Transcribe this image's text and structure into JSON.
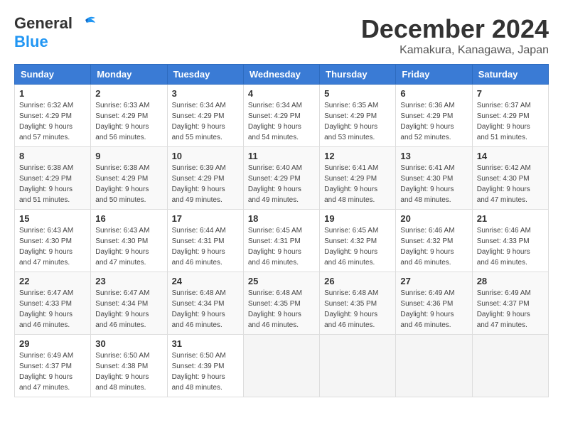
{
  "logo": {
    "general": "General",
    "blue": "Blue"
  },
  "header": {
    "month": "December 2024",
    "location": "Kamakura, Kanagawa, Japan"
  },
  "weekdays": [
    "Sunday",
    "Monday",
    "Tuesday",
    "Wednesday",
    "Thursday",
    "Friday",
    "Saturday"
  ],
  "weeks": [
    [
      {
        "day": "1",
        "sunrise": "6:32 AM",
        "sunset": "4:29 PM",
        "daylight": "9 hours and 57 minutes."
      },
      {
        "day": "2",
        "sunrise": "6:33 AM",
        "sunset": "4:29 PM",
        "daylight": "9 hours and 56 minutes."
      },
      {
        "day": "3",
        "sunrise": "6:34 AM",
        "sunset": "4:29 PM",
        "daylight": "9 hours and 55 minutes."
      },
      {
        "day": "4",
        "sunrise": "6:34 AM",
        "sunset": "4:29 PM",
        "daylight": "9 hours and 54 minutes."
      },
      {
        "day": "5",
        "sunrise": "6:35 AM",
        "sunset": "4:29 PM",
        "daylight": "9 hours and 53 minutes."
      },
      {
        "day": "6",
        "sunrise": "6:36 AM",
        "sunset": "4:29 PM",
        "daylight": "9 hours and 52 minutes."
      },
      {
        "day": "7",
        "sunrise": "6:37 AM",
        "sunset": "4:29 PM",
        "daylight": "9 hours and 51 minutes."
      }
    ],
    [
      {
        "day": "8",
        "sunrise": "6:38 AM",
        "sunset": "4:29 PM",
        "daylight": "9 hours and 51 minutes."
      },
      {
        "day": "9",
        "sunrise": "6:38 AM",
        "sunset": "4:29 PM",
        "daylight": "9 hours and 50 minutes."
      },
      {
        "day": "10",
        "sunrise": "6:39 AM",
        "sunset": "4:29 PM",
        "daylight": "9 hours and 49 minutes."
      },
      {
        "day": "11",
        "sunrise": "6:40 AM",
        "sunset": "4:29 PM",
        "daylight": "9 hours and 49 minutes."
      },
      {
        "day": "12",
        "sunrise": "6:41 AM",
        "sunset": "4:29 PM",
        "daylight": "9 hours and 48 minutes."
      },
      {
        "day": "13",
        "sunrise": "6:41 AM",
        "sunset": "4:30 PM",
        "daylight": "9 hours and 48 minutes."
      },
      {
        "day": "14",
        "sunrise": "6:42 AM",
        "sunset": "4:30 PM",
        "daylight": "9 hours and 47 minutes."
      }
    ],
    [
      {
        "day": "15",
        "sunrise": "6:43 AM",
        "sunset": "4:30 PM",
        "daylight": "9 hours and 47 minutes."
      },
      {
        "day": "16",
        "sunrise": "6:43 AM",
        "sunset": "4:30 PM",
        "daylight": "9 hours and 47 minutes."
      },
      {
        "day": "17",
        "sunrise": "6:44 AM",
        "sunset": "4:31 PM",
        "daylight": "9 hours and 46 minutes."
      },
      {
        "day": "18",
        "sunrise": "6:45 AM",
        "sunset": "4:31 PM",
        "daylight": "9 hours and 46 minutes."
      },
      {
        "day": "19",
        "sunrise": "6:45 AM",
        "sunset": "4:32 PM",
        "daylight": "9 hours and 46 minutes."
      },
      {
        "day": "20",
        "sunrise": "6:46 AM",
        "sunset": "4:32 PM",
        "daylight": "9 hours and 46 minutes."
      },
      {
        "day": "21",
        "sunrise": "6:46 AM",
        "sunset": "4:33 PM",
        "daylight": "9 hours and 46 minutes."
      }
    ],
    [
      {
        "day": "22",
        "sunrise": "6:47 AM",
        "sunset": "4:33 PM",
        "daylight": "9 hours and 46 minutes."
      },
      {
        "day": "23",
        "sunrise": "6:47 AM",
        "sunset": "4:34 PM",
        "daylight": "9 hours and 46 minutes."
      },
      {
        "day": "24",
        "sunrise": "6:48 AM",
        "sunset": "4:34 PM",
        "daylight": "9 hours and 46 minutes."
      },
      {
        "day": "25",
        "sunrise": "6:48 AM",
        "sunset": "4:35 PM",
        "daylight": "9 hours and 46 minutes."
      },
      {
        "day": "26",
        "sunrise": "6:48 AM",
        "sunset": "4:35 PM",
        "daylight": "9 hours and 46 minutes."
      },
      {
        "day": "27",
        "sunrise": "6:49 AM",
        "sunset": "4:36 PM",
        "daylight": "9 hours and 46 minutes."
      },
      {
        "day": "28",
        "sunrise": "6:49 AM",
        "sunset": "4:37 PM",
        "daylight": "9 hours and 47 minutes."
      }
    ],
    [
      {
        "day": "29",
        "sunrise": "6:49 AM",
        "sunset": "4:37 PM",
        "daylight": "9 hours and 47 minutes."
      },
      {
        "day": "30",
        "sunrise": "6:50 AM",
        "sunset": "4:38 PM",
        "daylight": "9 hours and 48 minutes."
      },
      {
        "day": "31",
        "sunrise": "6:50 AM",
        "sunset": "4:39 PM",
        "daylight": "9 hours and 48 minutes."
      },
      null,
      null,
      null,
      null
    ]
  ],
  "labels": {
    "sunrise": "Sunrise:",
    "sunset": "Sunset:",
    "daylight": "Daylight:"
  }
}
